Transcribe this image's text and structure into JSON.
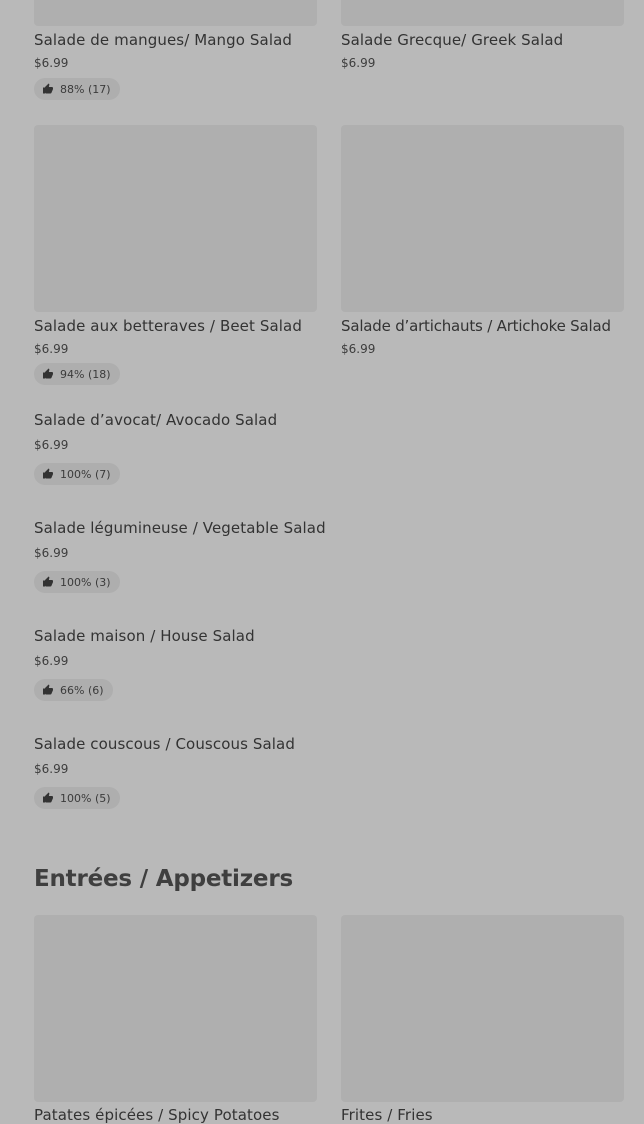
{
  "colors": {
    "page_background": "#b9b9b9",
    "image_placeholder": "#afafaf",
    "rating_pill": "#aeaeae",
    "text": "#333333"
  },
  "icons": {
    "rating": "thumbs-up-icon"
  },
  "salads": [
    {
      "name": "Salade de mangues/ Mango Salad",
      "price": "$6.99",
      "rating": "88% (17)"
    },
    {
      "name": "Salade Grecque/ Greek Salad",
      "price": "$6.99"
    },
    {
      "name": "Salade aux betteraves / Beet Salad",
      "price": "$6.99",
      "rating": "94% (18)"
    },
    {
      "name": "Salade d’artichauts / Artichoke Salad",
      "price": "$6.99"
    },
    {
      "name": "Salade d’avocat/ Avocado Salad",
      "price": "$6.99",
      "rating": "100% (7)"
    },
    {
      "name": "Salade légumineuse / Vegetable Salad",
      "price": "$6.99",
      "rating": "100% (3)"
    },
    {
      "name": "Salade maison / House Salad",
      "price": "$6.99",
      "rating": "66% (6)"
    },
    {
      "name": "Salade couscous / Couscous Salad",
      "price": "$6.99",
      "rating": "100% (5)"
    }
  ],
  "appetizers": {
    "section_title": "Entrées / Appetizers",
    "items": [
      {
        "name": "Patates épicées / Spicy Potatoes"
      },
      {
        "name": "Frites / Fries"
      }
    ]
  }
}
